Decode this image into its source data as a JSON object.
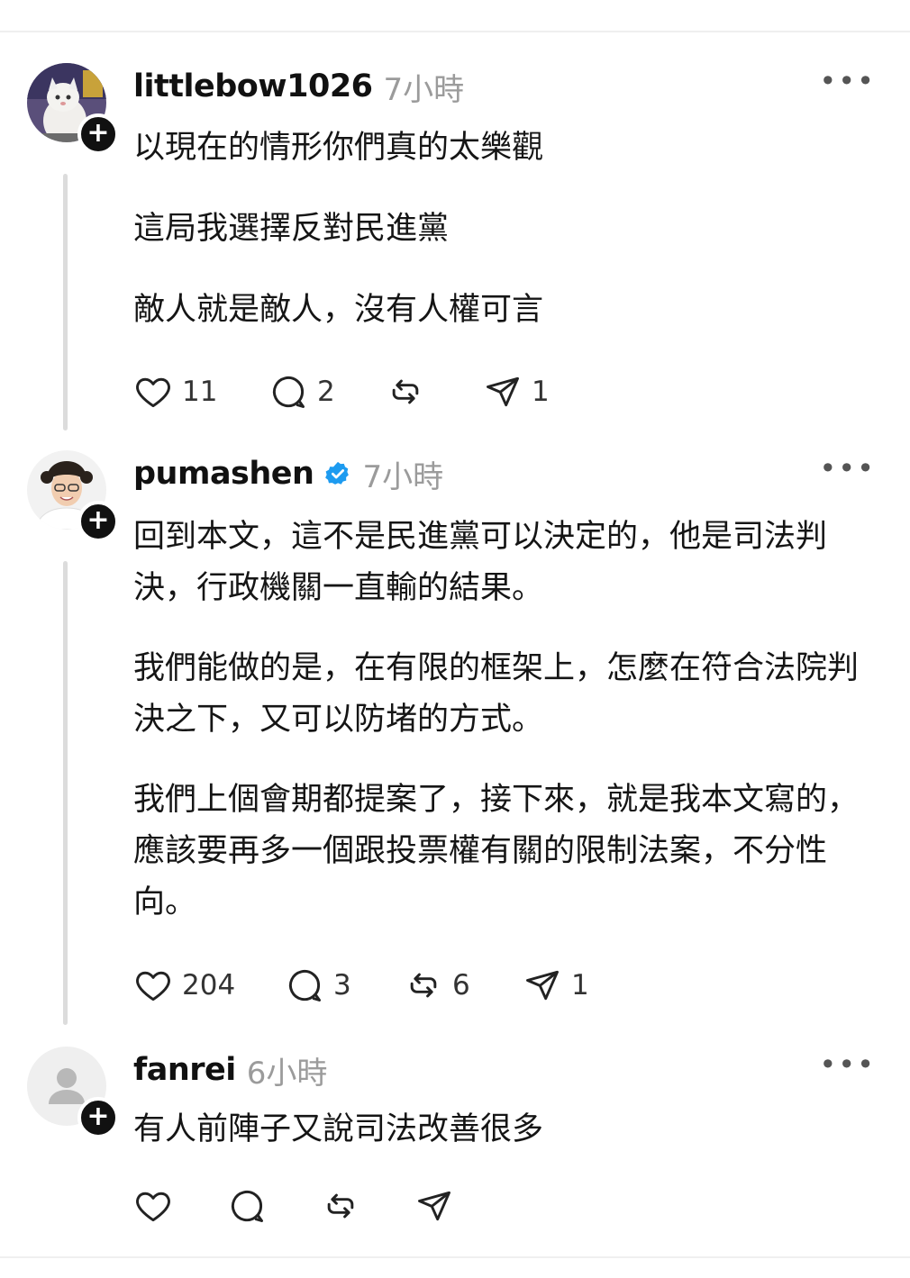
{
  "posts": [
    {
      "username": "littlebow1026",
      "time": "7小時",
      "verified": false,
      "lines": [
        "以現在的情形你們真的太樂觀",
        "這局我選擇反對民進黨",
        "敵人就是敵人，沒有人權可言"
      ],
      "likes": "11",
      "replies": "2",
      "reposts": "",
      "shares": "1"
    },
    {
      "username": "pumashen",
      "time": "7小時",
      "verified": true,
      "lines": [
        "回到本文，這不是民進黨可以決定的，他是司法判決，行政機關一直輸的結果。",
        "我們能做的是，在有限的框架上，怎麼在符合法院判決之下，又可以防堵的方式。",
        "我們上個會期都提案了，接下來，就是我本文寫的，應該要再多一個跟投票權有關的限制法案，不分性向。"
      ],
      "likes": "204",
      "replies": "3",
      "reposts": "6",
      "shares": "1"
    },
    {
      "username": "fanrei",
      "time": "6小時",
      "verified": false,
      "lines": [
        "有人前陣子又說司法改善很多"
      ],
      "likes": "",
      "replies": "",
      "reposts": "",
      "shares": ""
    }
  ],
  "icons": {
    "more": "more-options-icon",
    "like": "heart-icon",
    "reply": "comment-icon",
    "repost": "repost-icon",
    "share": "send-icon",
    "follow": "plus-icon",
    "verified": "verified-badge-icon"
  },
  "colors": {
    "verified": "#1d9bf0",
    "muted": "#9b9b9b",
    "thread_line": "#dcdcdc"
  },
  "plus_symbol": "+",
  "more_symbol": "•••"
}
